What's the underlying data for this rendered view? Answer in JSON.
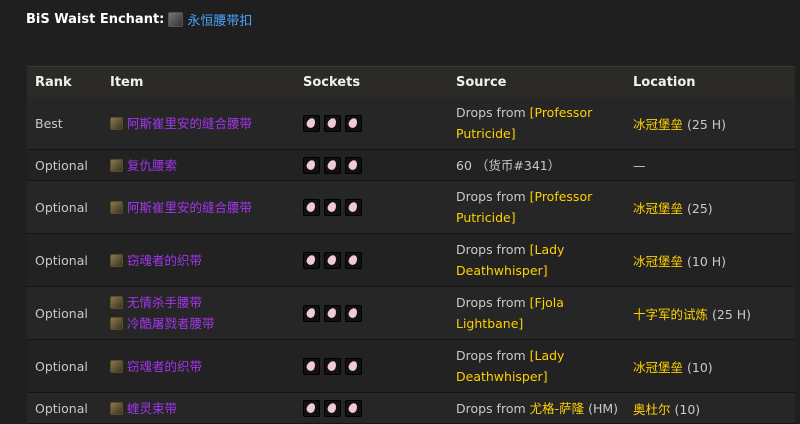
{
  "enchant": {
    "label": "BiS Waist Enchant:",
    "item": "永恒腰带扣"
  },
  "table": {
    "headers": {
      "rank": "Rank",
      "item": "Item",
      "sockets": "Sockets",
      "source": "Source",
      "location": "Location"
    },
    "rows": [
      {
        "rank": "Best",
        "items": [
          "阿斯崔里安的缝合腰带"
        ],
        "sockets": 3,
        "src_prefix": "Drops from ",
        "src_line1": "[Professor",
        "src_line2": "Putricide]",
        "location": "冰冠堡垒",
        "loc_suffix": " (25 H)"
      },
      {
        "rank": "Optional",
        "items": [
          "复仇腰索"
        ],
        "sockets": 3,
        "src_prefix": "60 ",
        "src_line1": "（货币#341）",
        "src_line2": "",
        "location": "",
        "loc_suffix": "—"
      },
      {
        "rank": "Optional",
        "items": [
          "阿斯崔里安的缝合腰带"
        ],
        "sockets": 3,
        "src_prefix": "Drops from ",
        "src_line1": "[Professor",
        "src_line2": "Putricide]",
        "location": "冰冠堡垒",
        "loc_suffix": " (25)"
      },
      {
        "rank": "Optional",
        "items": [
          "窃魂者的织带"
        ],
        "sockets": 3,
        "src_prefix": "Drops from ",
        "src_line1": "[Lady",
        "src_line2": "Deathwhisper]",
        "location": "冰冠堡垒",
        "loc_suffix": " (10 H)"
      },
      {
        "rank": "Optional",
        "items": [
          "无情杀手腰带",
          "冷酷屠戮者腰带"
        ],
        "sockets": 3,
        "src_prefix": "Drops from ",
        "src_line1": "[Fjola",
        "src_line2": "Lightbane]",
        "location": "十字军的试炼",
        "loc_suffix": " (25 H)"
      },
      {
        "rank": "Optional",
        "items": [
          "窃魂者的织带"
        ],
        "sockets": 3,
        "src_prefix": "Drops from ",
        "src_line1": "[Lady",
        "src_line2": "Deathwhisper]",
        "location": "冰冠堡垒",
        "loc_suffix": " (10)"
      },
      {
        "rank": "Optional",
        "items": [
          "蝰灵束带"
        ],
        "sockets": 3,
        "src_prefix": "Drops from ",
        "src_line1": "尤格-萨隆",
        "src_suffix": " (HM)",
        "src_line2": "",
        "location": "奥杜尔",
        "loc_suffix": " (10)"
      }
    ]
  }
}
